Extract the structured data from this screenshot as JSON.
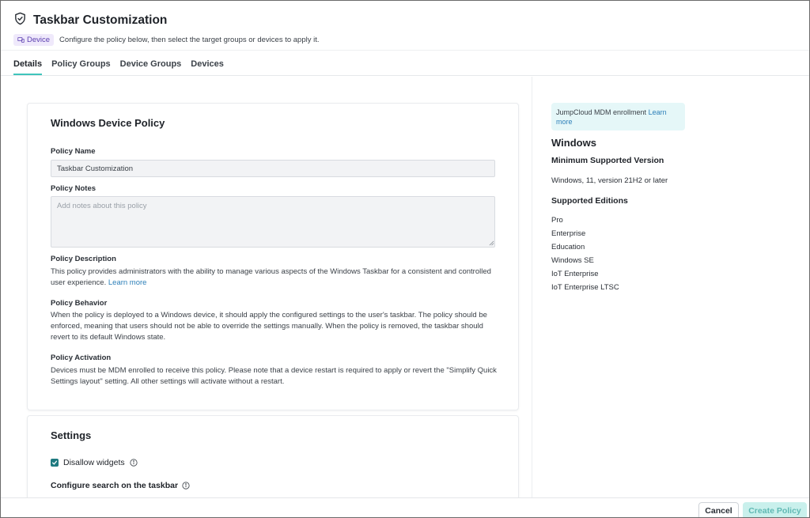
{
  "header": {
    "title": "Taskbar Customization",
    "badge": "Device",
    "subtitle": "Configure the policy below, then select the target groups or devices to apply it."
  },
  "tabs": [
    {
      "label": "Details",
      "active": true
    },
    {
      "label": "Policy Groups",
      "active": false
    },
    {
      "label": "Device Groups",
      "active": false
    },
    {
      "label": "Devices",
      "active": false
    }
  ],
  "policy_card": {
    "title": "Windows Device Policy",
    "name_label": "Policy Name",
    "name_value": "Taskbar Customization",
    "notes_label": "Policy Notes",
    "notes_placeholder": "Add notes about this policy",
    "description_label": "Policy Description",
    "description_text": "This policy provides administrators with the ability to manage various aspects of the Windows Taskbar for a consistent and controlled user experience.",
    "description_link": "Learn more",
    "behavior_label": "Policy Behavior",
    "behavior_text": "When the policy is deployed to a Windows device, it should apply the configured settings to the user's taskbar. The policy should be enforced, meaning that users should not be able to override the settings manually. When the policy is removed, the taskbar should revert to its default Windows state.",
    "activation_label": "Policy Activation",
    "activation_text": "Devices must be MDM enrolled to receive this policy. Please note that a device restart is required to apply or revert the \"Simplify Quick Settings layout\" setting. All other settings will activate without a restart."
  },
  "settings_card": {
    "title": "Settings",
    "disallow_widgets_label": "Disallow widgets",
    "disallow_widgets_checked": true,
    "search_label": "Configure search on the taskbar"
  },
  "sidebar": {
    "notice_text": "JumpCloud MDM enrollment",
    "notice_link": "Learn more",
    "os_title": "Windows",
    "min_version_label": "Minimum Supported Version",
    "min_version_value": "Windows, 11, version 21H2 or later",
    "editions_label": "Supported Editions",
    "editions": [
      "Pro",
      "Enterprise",
      "Education",
      "Windows SE",
      "IoT Enterprise",
      "IoT Enterprise LTSC"
    ]
  },
  "footer": {
    "cancel_label": "Cancel",
    "create_label": "Create Policy"
  },
  "colors": {
    "accent": "#3fc4bb",
    "link": "#2c7fb8",
    "badge_bg": "#efe9fb",
    "badge_text": "#5c3fb0",
    "notice_bg": "#e5f7f8",
    "checkbox": "#1f7a80",
    "create_button_bg": "#c9f0ec"
  }
}
